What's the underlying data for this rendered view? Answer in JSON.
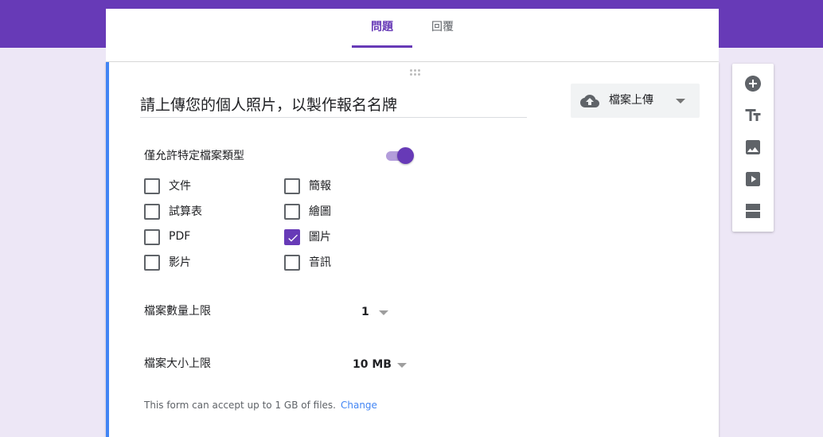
{
  "tabs": [
    {
      "label": "問題",
      "active": true
    },
    {
      "label": "回覆",
      "active": false
    }
  ],
  "question": {
    "title": "請上傳您的個人照片，以製作報名名牌",
    "type_label": "檔案上傳",
    "type_icon": "cloud-upload-icon"
  },
  "file_types": {
    "label": "僅允許特定檔案類型",
    "enabled": true,
    "options": [
      {
        "label": "文件",
        "checked": false
      },
      {
        "label": "試算表",
        "checked": false
      },
      {
        "label": "PDF",
        "checked": false
      },
      {
        "label": "影片",
        "checked": false
      },
      {
        "label": "簡報",
        "checked": false
      },
      {
        "label": "繪圖",
        "checked": false
      },
      {
        "label": "圖片",
        "checked": true
      },
      {
        "label": "音訊",
        "checked": false
      }
    ]
  },
  "max_files": {
    "label": "檔案數量上限",
    "value": "1"
  },
  "max_size": {
    "label": "檔案大小上限",
    "value": "10 MB"
  },
  "note": {
    "text": "This form can accept up to 1 GB of files.",
    "link": "Change"
  },
  "toolbar": [
    "add-question-icon",
    "title-text-icon",
    "image-icon",
    "video-icon",
    "section-icon"
  ],
  "colors": {
    "brand": "#673ab7",
    "accent": "#4285f4",
    "background": "#ede7f6"
  }
}
